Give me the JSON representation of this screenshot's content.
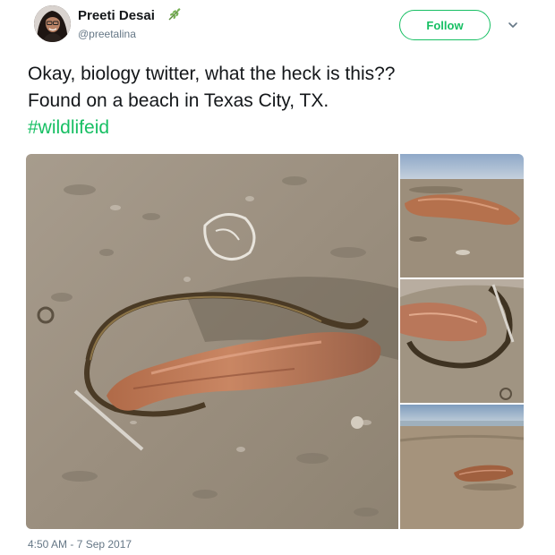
{
  "author": {
    "name": "Preeti Desai",
    "handle": "@preetalina",
    "avatar_icon": "profile-photo",
    "name_badge_icon": "leaf-sprig-emoji"
  },
  "actions": {
    "follow_label": "Follow",
    "more_icon": "chevron-down-icon"
  },
  "tweet": {
    "line1": "Okay, biology twitter, what the heck is this??",
    "line2": "Found on a beach in Texas City, TX.",
    "hashtag": "#wildlifeid"
  },
  "media": {
    "count": 4,
    "photos": [
      "creature on sand close-up",
      "creature on beach",
      "creature with seaweed",
      "creature on wide beach"
    ]
  },
  "timestamp": "4:50 AM - 7 Sep 2017",
  "colors": {
    "accent": "#17bf63",
    "text": "#14171a",
    "muted": "#657786"
  }
}
